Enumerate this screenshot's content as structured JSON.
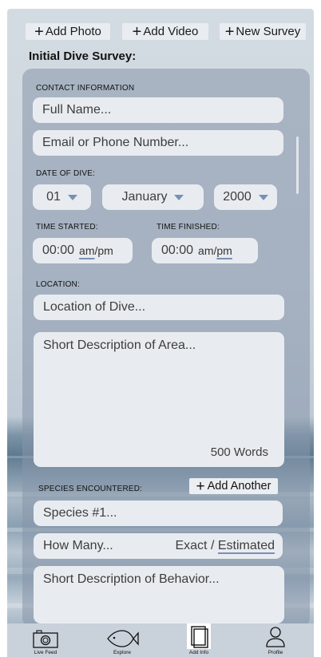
{
  "top_actions": {
    "add_photo": "Add Photo",
    "add_video": "Add Video",
    "new_survey": "New Survey"
  },
  "survey_title": "Initial Dive Survey:",
  "form": {
    "contact_label": "CONTACT INFORMATION",
    "full_name_placeholder": "Full Name...",
    "email_placeholder": "Email or Phone Number...",
    "date_label": "DATE OF DIVE:",
    "day": "01",
    "month": "January",
    "year": "2000",
    "time_started_label": "TIME STARTED:",
    "time_finished_label": "TIME FINISHED:",
    "time_started": "00:00",
    "time_finished": "00:00",
    "am_pm": "am/pm",
    "am": "am",
    "pm": "pm",
    "slash": "/",
    "location_label": "LOCATION:",
    "location_placeholder": "Location of Dive...",
    "area_placeholder": "Short Description of Area...",
    "word_limit": "500 Words",
    "species_label": "SPECIES ENCOUNTERED:",
    "add_another": "Add Another",
    "species_placeholder": "Species #1...",
    "how_many_placeholder": "How Many...",
    "exact": "Exact",
    "estimated": "Estimated",
    "behavior_placeholder": "Short Description of Behavior..."
  },
  "tabs": [
    {
      "label": "Live Feed",
      "icon": "camera-icon"
    },
    {
      "label": "Explore",
      "icon": "fish-icon"
    },
    {
      "label": "Add Info",
      "icon": "document-icon",
      "selected": true
    },
    {
      "label": "Profile",
      "icon": "person-icon"
    }
  ],
  "colors": {
    "accent": "#7a8fb5",
    "field_bg": "#e8ecf0",
    "card_bg": "#8696aa"
  }
}
